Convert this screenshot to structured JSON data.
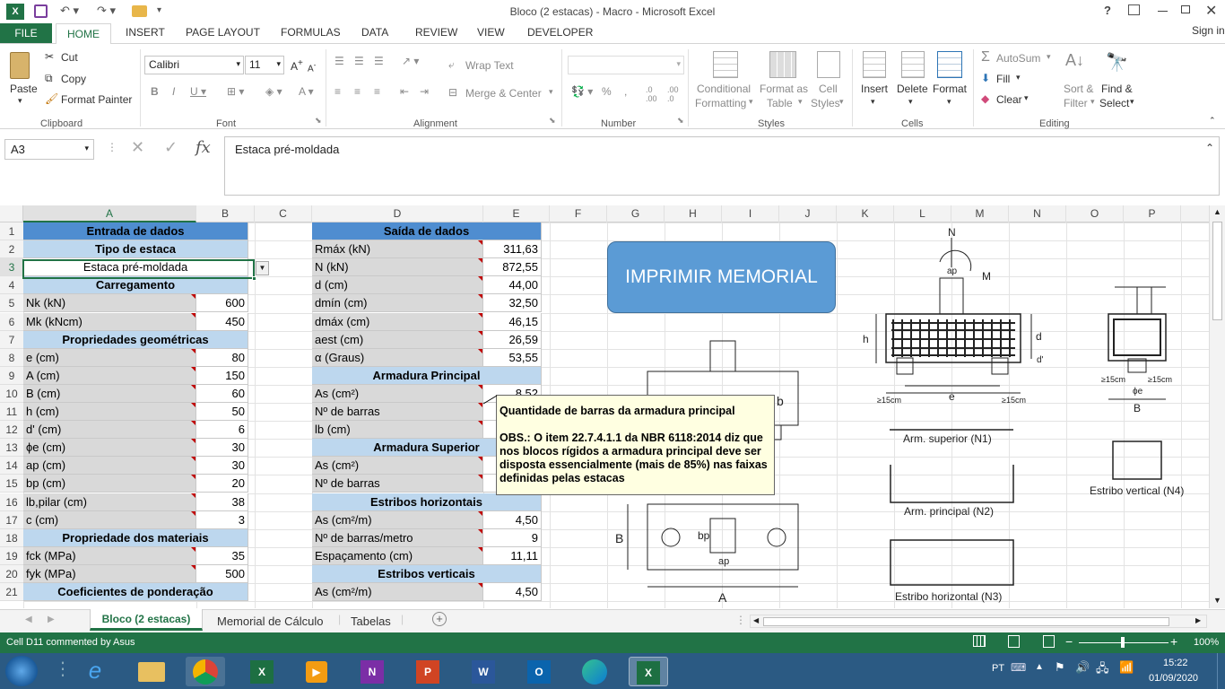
{
  "window": {
    "title": "Bloco (2 estacas) - Macro - Microsoft Excel",
    "help": "?",
    "sign_in": "Sign in"
  },
  "tabs": [
    "FILE",
    "HOME",
    "INSERT",
    "PAGE LAYOUT",
    "FORMULAS",
    "DATA",
    "REVIEW",
    "VIEW",
    "DEVELOPER"
  ],
  "ribbon": {
    "clipboard": {
      "paste": "Paste",
      "cut": "Cut",
      "copy": "Copy",
      "format_painter": "Format Painter",
      "group": "Clipboard"
    },
    "font": {
      "name": "Calibri",
      "size": "11",
      "group": "Font"
    },
    "alignment": {
      "wrap": "Wrap Text",
      "merge": "Merge & Center",
      "group": "Alignment"
    },
    "number": {
      "group": "Number"
    },
    "styles": {
      "cond": "Conditional",
      "cond2": "Formatting",
      "fmt_table": "Format as",
      "fmt_table2": "Table",
      "cell_styles": "Cell",
      "cell_styles2": "Styles",
      "group": "Styles"
    },
    "cells": {
      "insert": "Insert",
      "delete": "Delete",
      "format": "Format",
      "group": "Cells"
    },
    "editing": {
      "autosum": "AutoSum",
      "fill": "Fill",
      "clear": "Clear",
      "sort": "Sort &",
      "sort2": "Filter",
      "find": "Find &",
      "find2": "Select",
      "group": "Editing"
    }
  },
  "formula_bar": {
    "name_box": "A3",
    "fx": "fx",
    "content": "Estaca pré-moldada"
  },
  "columns": [
    "A",
    "B",
    "C",
    "D",
    "E",
    "F",
    "G",
    "H",
    "I",
    "J",
    "K",
    "L",
    "M",
    "N",
    "O",
    "P"
  ],
  "rows": [
    "1",
    "2",
    "3",
    "4",
    "5",
    "6",
    "7",
    "8",
    "9",
    "10",
    "11",
    "12",
    "13",
    "14",
    "15",
    "16",
    "17",
    "18",
    "19",
    "20",
    "21"
  ],
  "left": [
    {
      "t": "hdr",
      "a": "Entrada de dados"
    },
    {
      "t": "sub",
      "a": "Tipo de estaca"
    },
    {
      "t": "sel",
      "a": "Estaca pré-moldada"
    },
    {
      "t": "sub",
      "a": "Carregamento"
    },
    {
      "t": "row",
      "a": "Nk (kN)",
      "b": "600"
    },
    {
      "t": "row",
      "a": "Mk (kNcm)",
      "b": "450"
    },
    {
      "t": "sub",
      "a": "Propriedades geométricas"
    },
    {
      "t": "row",
      "a": "e (cm)",
      "b": "80"
    },
    {
      "t": "row",
      "a": "A (cm)",
      "b": "150"
    },
    {
      "t": "row",
      "a": "B (cm)",
      "b": "60"
    },
    {
      "t": "row",
      "a": "h (cm)",
      "b": "50"
    },
    {
      "t": "row",
      "a": "d' (cm)",
      "b": "6"
    },
    {
      "t": "row",
      "a": "ϕe (cm)",
      "b": "30"
    },
    {
      "t": "row",
      "a": "ap (cm)",
      "b": "30"
    },
    {
      "t": "row",
      "a": "bp (cm)",
      "b": "20"
    },
    {
      "t": "row",
      "a": "lb,pilar (cm)",
      "b": "38"
    },
    {
      "t": "row",
      "a": "c (cm)",
      "b": "3"
    },
    {
      "t": "sub",
      "a": "Propriedade dos materiais"
    },
    {
      "t": "row",
      "a": "fck (MPa)",
      "b": "35"
    },
    {
      "t": "row",
      "a": "fyk (MPa)",
      "b": "500"
    },
    {
      "t": "sub",
      "a": "Coeficientes de ponderação"
    }
  ],
  "right": [
    {
      "t": "hdr",
      "a": "Saída de dados"
    },
    {
      "t": "row",
      "a": "Rmáx (kN)",
      "b": "311,63"
    },
    {
      "t": "row",
      "a": "N (kN)",
      "b": "872,55"
    },
    {
      "t": "row",
      "a": "d (cm)",
      "b": "44,00"
    },
    {
      "t": "row",
      "a": "dmín (cm)",
      "b": "32,50"
    },
    {
      "t": "row",
      "a": "dmáx (cm)",
      "b": "46,15"
    },
    {
      "t": "row",
      "a": "aest (cm)",
      "b": "26,59"
    },
    {
      "t": "row",
      "a": "α (Graus)",
      "b": "53,55"
    },
    {
      "t": "sub",
      "a": "Armadura Principal"
    },
    {
      "t": "row",
      "a": "As (cm²)",
      "b": "8,52"
    },
    {
      "t": "row",
      "a": "Nº de barras",
      "b": ""
    },
    {
      "t": "row",
      "a": "lb (cm)",
      "b": ""
    },
    {
      "t": "sub",
      "a": "Armadura Superior"
    },
    {
      "t": "row",
      "a": "As (cm²)",
      "b": ""
    },
    {
      "t": "row",
      "a": "Nº de barras",
      "b": ""
    },
    {
      "t": "sub",
      "a": "Estribos horizontais"
    },
    {
      "t": "row",
      "a": "As (cm²/m)",
      "b": "4,50"
    },
    {
      "t": "row",
      "a": "Nº de barras/metro",
      "b": "9"
    },
    {
      "t": "row",
      "a": "Espaçamento (cm)",
      "b": "11,11"
    },
    {
      "t": "sub",
      "a": "Estribos verticais"
    },
    {
      "t": "row",
      "a": "As (cm²/m)",
      "b": "4,50"
    }
  ],
  "print_button": "IMPRIMIR MEMORIAL",
  "tooltip": {
    "title": "Quantidade de barras da armadura principal",
    "body": "OBS.: O item 22.7.4.1.1 da NBR 6118:2014 diz que nos blocos rígidos a armadura principal deve ser disposta essencialmente (mais de 85%) nas faixas definidas pelas estacas"
  },
  "drawing": {
    "N": "N",
    "M": "M",
    "ap": "ap",
    "h": "h",
    "d": "d",
    "dprime": "d'",
    "e": "e",
    "ge15a": "≥15cm",
    "ge15b": "≥15cm",
    "ge15c": "≥15cm",
    "ge15d": "≥15cm",
    "phie": "ϕe",
    "B": "B",
    "B2": "B",
    "A": "A",
    "bp": "bp",
    "ap2": "ap",
    "b": "b",
    "n1": "Arm. superior (N1)",
    "n2": "Arm. principal (N2)",
    "n3": "Estribo horizontal (N3)",
    "n4": "Estribo vertical (N4)"
  },
  "sheets": [
    "Bloco (2 estacas)",
    "Memorial de Cálculo",
    "Tabelas"
  ],
  "status": {
    "text": "Cell D11 commented by Asus",
    "zoom": "100%"
  },
  "taskbar": {
    "lang": "PT",
    "time": "15:22",
    "date": "01/09/2020"
  },
  "colors": {
    "excel_green": "#217346",
    "header_blue": "#4f8dd0",
    "sub_blue": "#bdd7ee",
    "label_gray": "#d9d9d9"
  }
}
